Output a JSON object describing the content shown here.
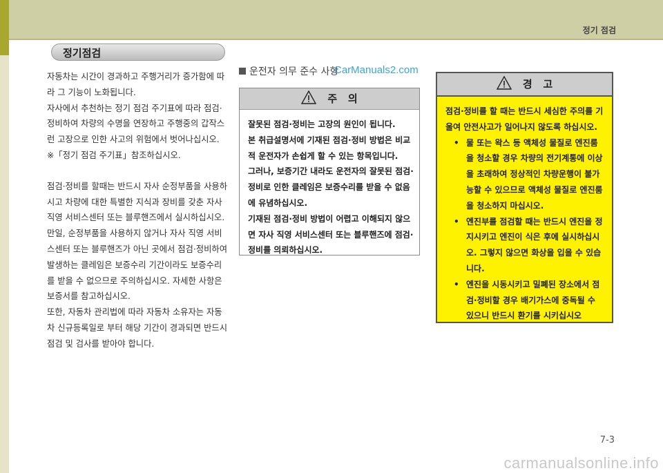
{
  "header": {
    "chapter_title": "정기 점검"
  },
  "section": {
    "title": "정기점검"
  },
  "left_column": {
    "paragraphs": [
      "자동차는 시간이 경과하고 주행거리가 증가함에 따라 그 기능이 노화됩니다.",
      "자사에서 추천하는 정기 점검 주기표에 따라 점검·정비하여 차량의 수명을 연장하고 주행중의 갑작스런 고장으로 인한 사고의 위험에서 벗어나십시오.",
      "※「정기 점검 주기표」참조하십시오.",
      "점검·정비를 할때는 반드시 자사 순정부품을 사용하시고 차량에 대한 특별한 지식과 장비를 갖춘 자사 직영 서비스센터 또는 블루핸즈에서 실시하십시오.",
      "만일, 순정부품을 사용하지 않거나 자사 직영 서비스센터 또는 블루핸즈가 아닌 곳에서 점검·정비하여 발생하는 클레임은 보증수리 기간이라도 보증수리를 받을 수 없으므로 주의하십시오. 자세한 사항은 보증서를 참고하십시오.",
      "또한, 자동차 관리법에 따라 자동차 소유자는 자동차 신규등록일로 부터 해당 기간이 경과되면 반드시 점검 및 검사를 받아야 합니다."
    ]
  },
  "middle": {
    "heading": "운전자 의무 준수 사항",
    "caution": {
      "title": "주   의",
      "paragraphs": [
        "잘못된 점검·정비는 고장의 원인이 됩니다.",
        "본 취급설명서에 기재된 점검·정비 방법은 비교적 운전자가 손쉽게 할 수 있는 항목입니다.",
        "그러나, 보증기간 내라도 운전자의 잘못된 점검·정비로 인한 클레임은 보증수리를 받을 수 없음에 유념하십시오.",
        "기재된 점검·정비 방법이 어렵고 이해되지 않으면 자사 직영 서비스센터 또는 블루핸즈에 점검·정비를 의뢰하십시오."
      ]
    }
  },
  "warning": {
    "title": "경   고",
    "intro": "점검·정비를 할 때는 반드시 세심한 주의를 기울여 안전사고가 일어나지 않도록 하십시오.",
    "items": [
      "물 또는 왁스 등 액체성 물질로 엔진룸을 청소할 경우 차량의 전기계통에 이상을 초래하여 정상적인 차량운행이 불가능할 수 있으므로 액체성 물질로 엔진룸을 청소하지 마십시오.",
      "엔진부를 점검할 때는 반드시 엔진을 정지시키고 엔진이 식은 후에 실시하십시오. 그렇지 않으면 화상을 입을 수 있습니다.",
      "엔진을 시동시키고 밀폐된 장소에서 점검·정비할 경우 배기가스에 중독될 수 있으니 반드시 환기를 시키십시오"
    ]
  },
  "footer": {
    "page_number": "7-3"
  },
  "watermarks": {
    "top": "CarManuals2.com",
    "bottom": "carmanualsonline.info"
  },
  "colors": {
    "warning_bg": "#fff200",
    "top_band": "#cfcfa6",
    "side_accent": "#a8a830"
  },
  "icons": [
    "warning-triangle-icon"
  ]
}
